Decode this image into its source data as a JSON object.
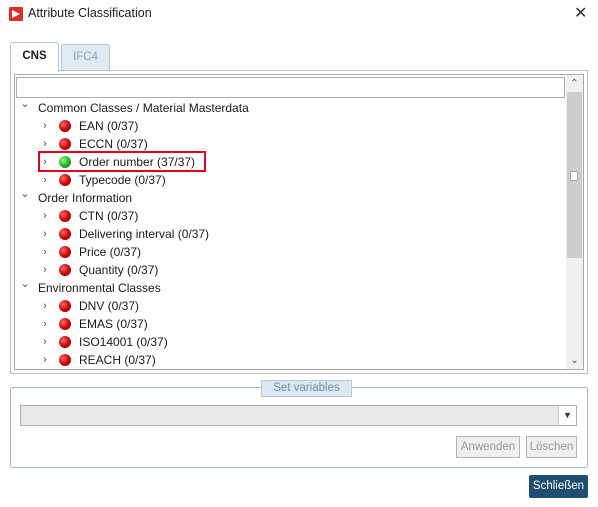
{
  "window": {
    "title": "Attribute Classification",
    "close_glyph": "✕"
  },
  "tabs": [
    {
      "label": "CNS",
      "active": true
    },
    {
      "label": "IFC4",
      "active": false
    }
  ],
  "tree": {
    "filter_value": "",
    "rows": [
      {
        "label": "Common Classes / Material Masterdata",
        "level": 0,
        "expanded": true
      },
      {
        "label": "EAN (0/37)",
        "level": 1,
        "status": "red"
      },
      {
        "label": "ECCN (0/37)",
        "level": 1,
        "status": "red"
      },
      {
        "label": "Order number (37/37)",
        "level": 1,
        "status": "green",
        "highlighted": true
      },
      {
        "label": "Typecode (0/37)",
        "level": 1,
        "status": "red"
      },
      {
        "label": "Order Information",
        "level": 0,
        "expanded": true
      },
      {
        "label": "CTN (0/37)",
        "level": 1,
        "status": "red"
      },
      {
        "label": "Delivering interval (0/37)",
        "level": 1,
        "status": "red"
      },
      {
        "label": "Price (0/37)",
        "level": 1,
        "status": "red"
      },
      {
        "label": "Quantity (0/37)",
        "level": 1,
        "status": "red"
      },
      {
        "label": "Environmental Classes",
        "level": 0,
        "expanded": true
      },
      {
        "label": "DNV (0/37)",
        "level": 1,
        "status": "red"
      },
      {
        "label": "EMAS (0/37)",
        "level": 1,
        "status": "red"
      },
      {
        "label": "ISO14001 (0/37)",
        "level": 1,
        "status": "red"
      },
      {
        "label": "REACH (0/37)",
        "level": 1,
        "status": "red"
      }
    ]
  },
  "set_variables": {
    "legend": "Set variables",
    "combo_value": "",
    "apply_label": "Anwenden",
    "delete_label": "Löschen"
  },
  "footer": {
    "close_label": "Schließen"
  },
  "colors": {
    "highlight": "#e3001b",
    "status_red": "#c40000",
    "status_green": "#22b022",
    "primary_button": "#1f4e6e"
  }
}
